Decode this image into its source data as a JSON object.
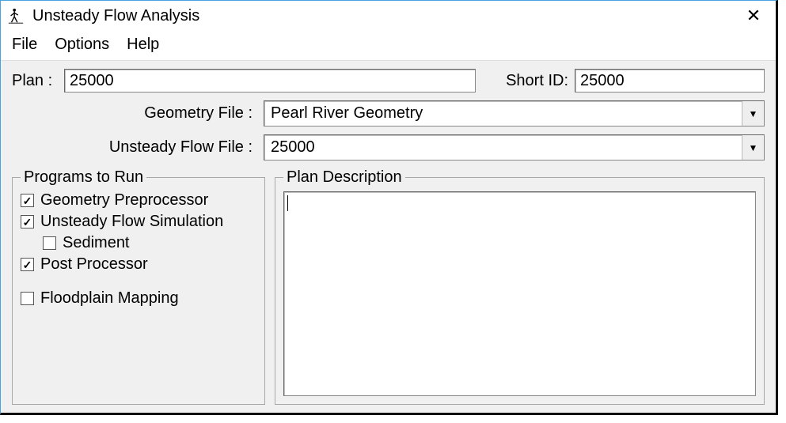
{
  "window": {
    "title": "Unsteady Flow Analysis",
    "close_icon": "✕"
  },
  "menu": {
    "file": "File",
    "options": "Options",
    "help": "Help"
  },
  "plan": {
    "label": "Plan :",
    "value": "25000",
    "short_id_label": "Short ID:",
    "short_id_value": "25000"
  },
  "geometry": {
    "label": "Geometry File :",
    "value": "Pearl River Geometry"
  },
  "unsteady_flow_file": {
    "label": "Unsteady Flow File :",
    "value": "25000"
  },
  "programs_group": {
    "legend": "Programs to Run",
    "items": {
      "geometry_preproc": {
        "label": "Geometry Preprocessor",
        "checked": true
      },
      "unsteady_sim": {
        "label": "Unsteady Flow Simulation",
        "checked": true
      },
      "sediment": {
        "label": "Sediment",
        "checked": false
      },
      "post_proc": {
        "label": "Post Processor",
        "checked": true
      },
      "floodplain": {
        "label": "Floodplain Mapping",
        "checked": false
      }
    }
  },
  "plan_desc": {
    "legend": "Plan Description",
    "value": ""
  }
}
